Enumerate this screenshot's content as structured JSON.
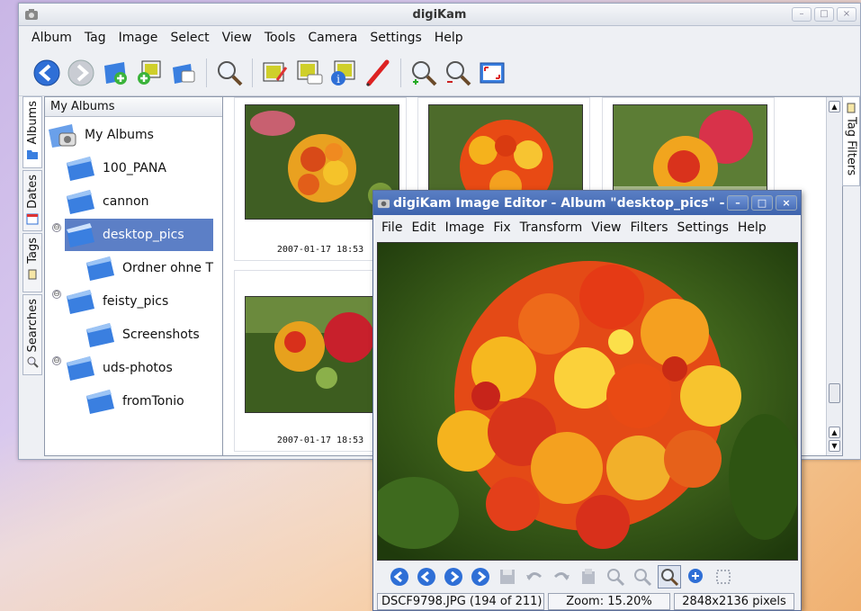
{
  "main_window": {
    "title": "digiKam",
    "menu": [
      "Album",
      "Tag",
      "Image",
      "Select",
      "View",
      "Tools",
      "Camera",
      "Settings",
      "Help"
    ],
    "toolbar_icons": [
      "back-icon",
      "forward-icon",
      "new-album-icon",
      "add-images-icon",
      "album-properties-icon",
      "search-icon",
      "edit-image-icon",
      "image-comment-icon",
      "image-properties-icon",
      "rotate-pen-icon",
      "zoom-in-icon",
      "zoom-out-icon",
      "fullscreen-icon"
    ]
  },
  "sidebar": {
    "tabs": [
      "Albums",
      "Dates",
      "Tags",
      "Searches"
    ],
    "tree_header": "My Albums",
    "nodes": [
      {
        "label": "My Albums",
        "level": 0,
        "type": "root"
      },
      {
        "label": "100_PANA",
        "level": 1
      },
      {
        "label": "cannon",
        "level": 1
      },
      {
        "label": "desktop_pics",
        "level": 1,
        "selected": true,
        "expand": "⊖"
      },
      {
        "label": "Ordner ohne T",
        "level": 2
      },
      {
        "label": "feisty_pics",
        "level": 1,
        "expand": "⊖"
      },
      {
        "label": "Screenshots",
        "level": 2
      },
      {
        "label": "uds-photos",
        "level": 1,
        "expand": "⊖"
      },
      {
        "label": "fromTonio",
        "level": 2
      }
    ]
  },
  "icon_view": {
    "thumbnails": [
      {
        "date": "2007-01-17 18:53"
      },
      {
        "date": ""
      },
      {
        "date": ""
      },
      {
        "date": "2007-01-17 18:53"
      }
    ]
  },
  "right_tab": {
    "label": "Tag Filters"
  },
  "editor": {
    "title": "digiKam Image Editor - Album \"desktop_pics\" -",
    "menu": [
      "File",
      "Edit",
      "Image",
      "Fix",
      "Transform",
      "View",
      "Filters",
      "Settings",
      "Help"
    ],
    "status": {
      "file": "DSCF9798.JPG (194 of 211)",
      "zoom": "Zoom: 15.20%",
      "size": "2848x2136 pixels"
    }
  },
  "colors": {
    "selection": "#5c7fc6",
    "editor_title": "#4a6fb8",
    "accent_blue": "#2f6fd6"
  }
}
